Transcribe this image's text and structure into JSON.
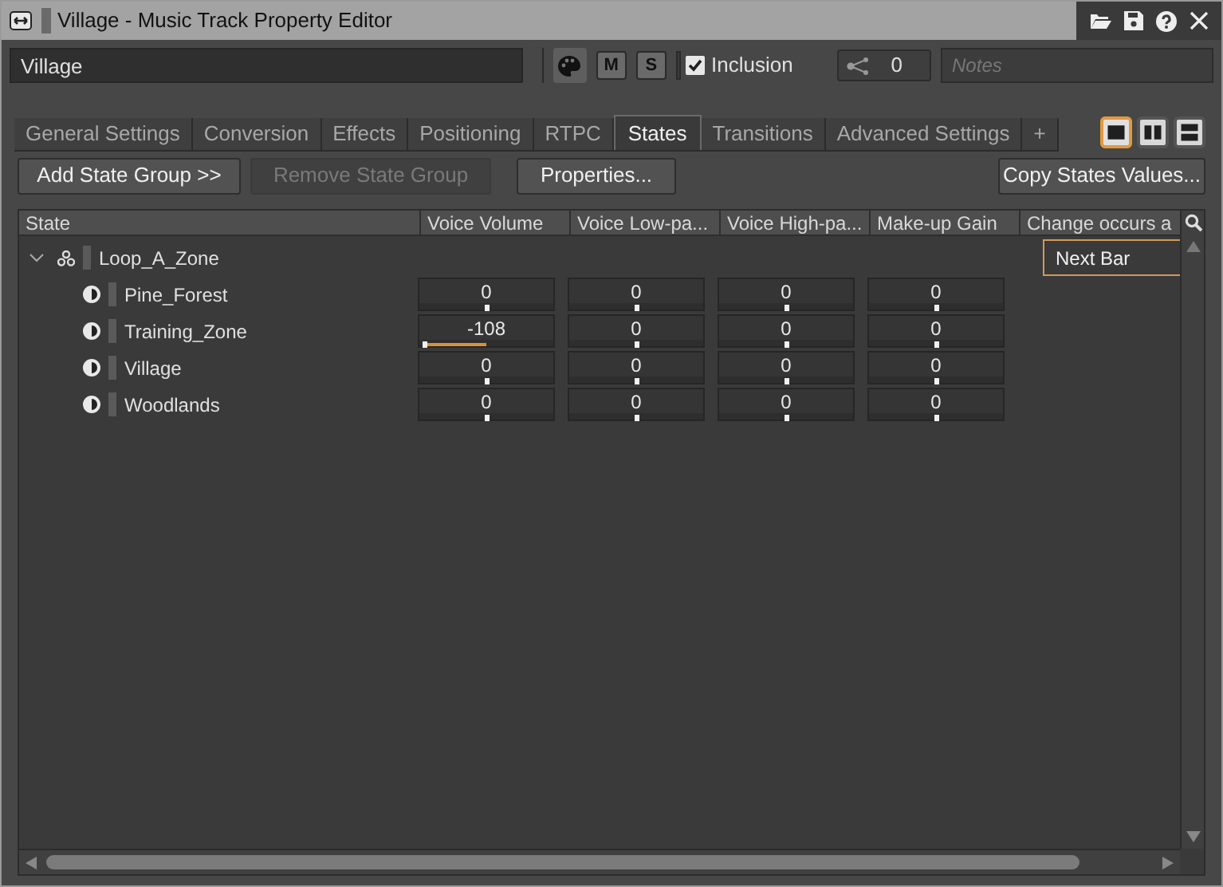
{
  "window": {
    "title": "Village - Music Track Property Editor"
  },
  "toolbar": {
    "name_value": "Village",
    "mute_label": "M",
    "solo_label": "S",
    "inclusion": {
      "label": "Inclusion",
      "checked": true
    },
    "share_count": "0",
    "notes": {
      "placeholder": "Notes"
    }
  },
  "tabs": [
    {
      "label": "General Settings",
      "selected": false
    },
    {
      "label": "Conversion",
      "selected": false
    },
    {
      "label": "Effects",
      "selected": false
    },
    {
      "label": "Positioning",
      "selected": false
    },
    {
      "label": "RTPC",
      "selected": false
    },
    {
      "label": "States",
      "selected": true
    },
    {
      "label": "Transitions",
      "selected": false
    },
    {
      "label": "Advanced Settings",
      "selected": false
    },
    {
      "label": "+",
      "selected": false
    }
  ],
  "layout_buttons": [
    {
      "kind": "single",
      "selected": true
    },
    {
      "kind": "columns",
      "selected": false
    },
    {
      "kind": "rows",
      "selected": false
    }
  ],
  "actions": [
    {
      "label": "Add State Group >>",
      "disabled": false
    },
    {
      "label": "Remove State Group",
      "disabled": true
    },
    {
      "label": "Properties...",
      "disabled": false
    },
    {
      "label": "Copy States Values...",
      "disabled": false
    }
  ],
  "table": {
    "columns": [
      "State",
      "Voice Volume",
      "Voice Low-pa...",
      "Voice High-pa...",
      "Make-up Gain",
      "Change occurs a"
    ],
    "group": {
      "name": "Loop_A_Zone",
      "expanded": true,
      "change_occurs": "Next Bar",
      "children": [
        {
          "name": "Pine_Forest",
          "values": [
            {
              "value": "0",
              "level": 0.5
            },
            {
              "value": "0",
              "level": 0.5
            },
            {
              "value": "0",
              "level": 0.5
            },
            {
              "value": "0",
              "level": 0.5
            }
          ]
        },
        {
          "name": "Training_Zone",
          "values": [
            {
              "value": "-108",
              "level": 0.02
            },
            {
              "value": "0",
              "level": 0.5
            },
            {
              "value": "0",
              "level": 0.5
            },
            {
              "value": "0",
              "level": 0.5
            }
          ]
        },
        {
          "name": "Village",
          "values": [
            {
              "value": "0",
              "level": 0.5
            },
            {
              "value": "0",
              "level": 0.5
            },
            {
              "value": "0",
              "level": 0.5
            },
            {
              "value": "0",
              "level": 0.5
            }
          ]
        },
        {
          "name": "Woodlands",
          "values": [
            {
              "value": "0",
              "level": 0.5
            },
            {
              "value": "0",
              "level": 0.5
            },
            {
              "value": "0",
              "level": 0.5
            },
            {
              "value": "0",
              "level": 0.5
            }
          ]
        }
      ]
    }
  }
}
